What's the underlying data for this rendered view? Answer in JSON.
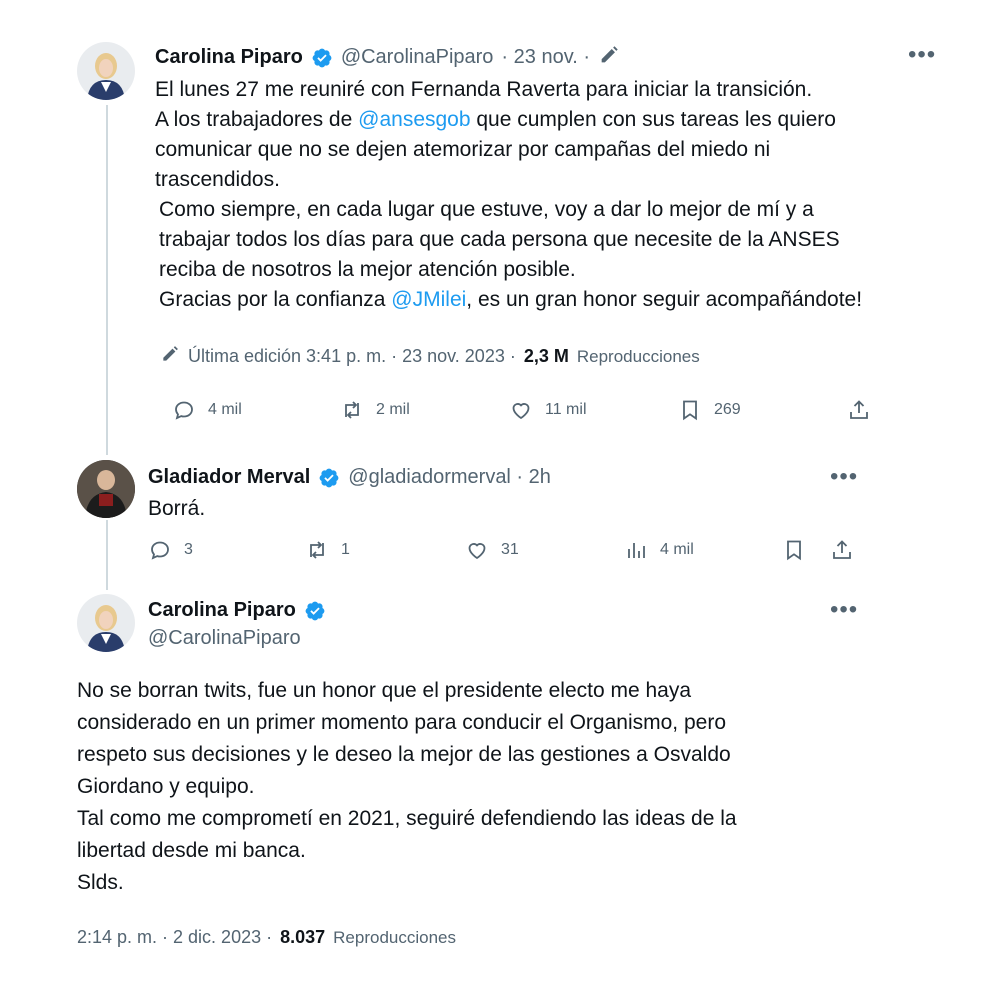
{
  "tweet1": {
    "name": "Carolina Piparo",
    "handle": "@CarolinaPiparo",
    "date": "· 23 nov. ·",
    "line1": "El lunes 27 me reuniré con Fernanda Raverta para iniciar la transición.",
    "line2_pre": "A los trabajadores de ",
    "line2_link": "@ansesgob",
    "line2_post": " que cumplen con sus tareas les quiero",
    "line3": "comunicar que no se dejen atemorizar por campañas del miedo ni",
    "line4": "trascendidos.",
    "line5": "Como siempre, en cada lugar que estuve, voy a dar lo mejor de mí y a",
    "line6": "trabajar todos los días para que cada persona que necesite de la ANSES",
    "line7": "reciba de nosotros la mejor atención posible.",
    "line8_pre": "Gracias por la confianza ",
    "line8_link": "@JMilei",
    "line8_post": ", es un gran honor seguir acompañándote!",
    "edit_label": "Última edición 3:41 p. m. · 23 nov. 2023 ·",
    "views_count": "2,3 M",
    "views_label": "Reproducciones",
    "replies": "4 mil",
    "retweets": "2 mil",
    "likes": "11 mil",
    "bookmarks": "269"
  },
  "tweet2": {
    "name": "Gladiador Merval",
    "handle": "@gladiadormerval · 2h",
    "text": "Borrá.",
    "replies": "3",
    "retweets": "1",
    "likes": "31",
    "views": "4 mil"
  },
  "tweet3": {
    "name": "Carolina Piparo",
    "handle": "@CarolinaPiparo",
    "line1": "No se borran twits, fue un honor que el presidente electo me haya",
    "line2": "considerado en un primer momento para conducir el Organismo, pero",
    "line3": "respeto sus decisiones y le deseo la mejor de las gestiones a Osvaldo",
    "line4": "Giordano y equipo.",
    "line5": "Tal como me comprometí en 2021, seguiré defendiendo las ideas de la",
    "line6": "libertad desde mi banca.",
    "line7": "Slds.",
    "timestamp": "2:14 p. m. · 2 dic. 2023 ·",
    "views_count": "8.037",
    "views_label": "Reproducciones"
  },
  "colors": {
    "accent": "#1d9bf0",
    "muted": "#536471",
    "line": "#cfd9de"
  }
}
